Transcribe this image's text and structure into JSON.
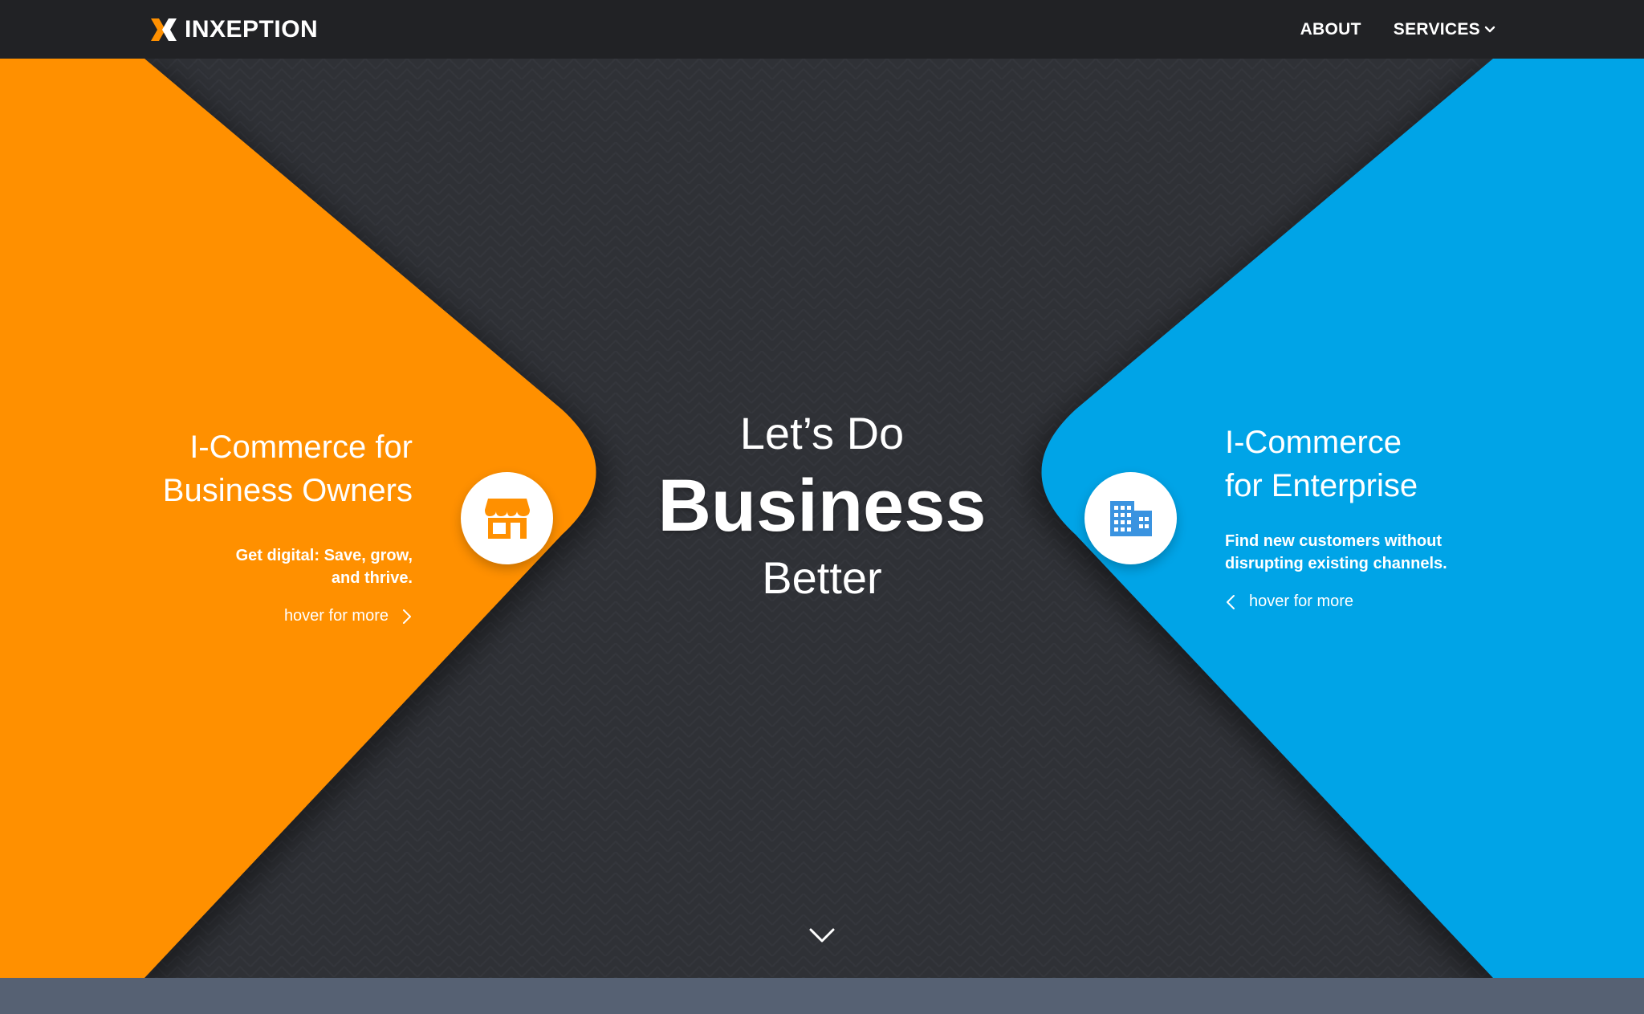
{
  "brand": {
    "name": "INXEPTION",
    "accent": "#ff9000",
    "nav_bg": "#212225"
  },
  "nav": {
    "about": "ABOUT",
    "services": "SERVICES"
  },
  "hero": {
    "headline_line1": "Let’s Do",
    "headline_line2": "Business",
    "headline_line3": "Better",
    "background": "#2f3136"
  },
  "left_panel": {
    "color": "#ff9000",
    "title_line1": "I-Commerce for",
    "title_line2": "Business Owners",
    "desc_line1": "Get digital: Save, grow,",
    "desc_line2": "and thrive.",
    "hover_text": "hover for more",
    "icon": "storefront-icon"
  },
  "right_panel": {
    "color": "#00a4e7",
    "title_line1": "I-Commerce",
    "title_line2": "for Enterprise",
    "desc_line1": "Find new customers without",
    "desc_line2": "disrupting existing channels.",
    "hover_text": "hover for more",
    "icon": "building-icon"
  },
  "footer_strip": {
    "color": "#566173"
  }
}
